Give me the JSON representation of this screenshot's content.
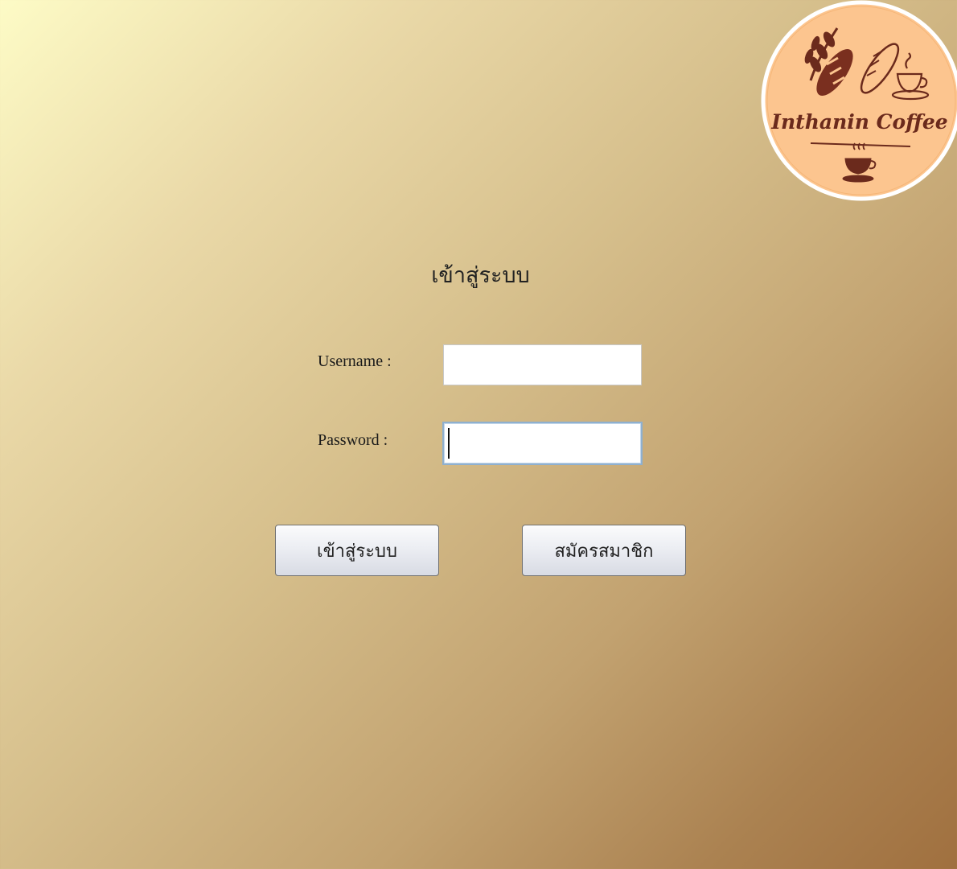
{
  "brand": {
    "logo_text": "Inthanin Coffee"
  },
  "form": {
    "title": "เข้าสู่ระบบ",
    "username_label": "Username :",
    "username_value": "",
    "password_label": "Password :",
    "password_value": ""
  },
  "buttons": {
    "login_label": "เข้าสู่ระบบ",
    "register_label": "สมัครสมาชิก"
  },
  "icons": [
    "logo-icon",
    "wheat-icon",
    "bread-icon",
    "coffee-cup-icon"
  ],
  "colors": {
    "background_start": "#fdfbc6",
    "background_end": "#a0703f",
    "logo_fill": "#fcc58f",
    "logo_ink": "#6b2a1c"
  }
}
